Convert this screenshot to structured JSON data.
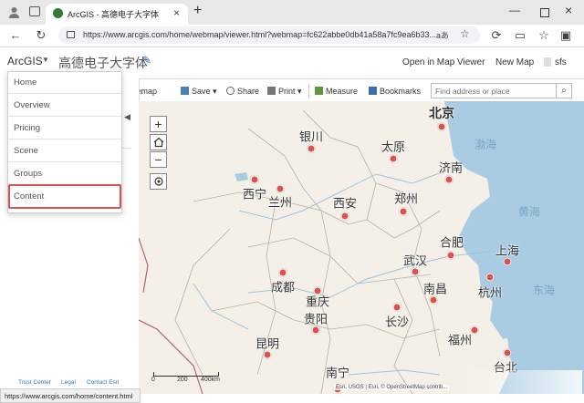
{
  "browser": {
    "tab_title": "ArcGIS - 高德电子大字体",
    "url": "https://www.arcgis.com/home/webmap/viewer.html?webmap=fc622abbe0db41a58a7fc9ea6b33..."
  },
  "app": {
    "logo": "ArcGIS",
    "map_title": "高德电子大字体",
    "open_in_map_viewer": "Open in Map Viewer",
    "new_map": "New Map",
    "user": "sfs"
  },
  "menu": {
    "items": [
      "Home",
      "Overview",
      "Pricing",
      "Scene",
      "Groups",
      "Content"
    ],
    "highlighted": "Content"
  },
  "toolbar": {
    "basemap": "Basemap",
    "save": "Save",
    "share": "Share",
    "print": "Print",
    "measure": "Measure",
    "bookmarks": "Bookmarks",
    "search_placeholder": "Find address or place"
  },
  "map": {
    "cities": [
      "北京",
      "银川",
      "太原",
      "济南",
      "西宁",
      "兰州",
      "西安",
      "郑州",
      "合肥",
      "上海",
      "武汉",
      "成都",
      "杭州",
      "重庆",
      "南昌",
      "贵阳",
      "长沙",
      "昆明",
      "福州",
      "南宁",
      "台北"
    ],
    "seas": [
      "渤海",
      "黄海",
      "东海"
    ],
    "scale_labels": [
      "0",
      "200",
      "400km"
    ],
    "attribution": "Esri, USGS | Esri, © OpenStreetMap contrib..."
  },
  "footer_links": [
    "Trust Center",
    "Legal",
    "Contact Esri"
  ],
  "status_url": "https://www.arcgis.com/home/content.html",
  "colors": {
    "highlight_border": "#d9534f",
    "city_dot": "#d9534f",
    "water": "#a9cce3",
    "land": "#f4f0e8"
  }
}
